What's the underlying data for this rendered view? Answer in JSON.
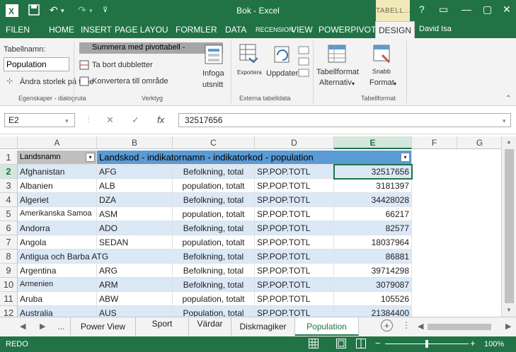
{
  "window": {
    "title": "Bok - Excel",
    "context_tab": "TABELL...",
    "controls": [
      "?",
      "▭",
      "—",
      "▢",
      "✕"
    ]
  },
  "tabs": {
    "file": "FILEN",
    "home": "HOME",
    "insert": "INSERT",
    "page_layout": "PAGE LAYOU",
    "formulas": "FORMLER",
    "data": "DATA",
    "review": "RECENSION",
    "view": "VIEW",
    "powerpivot": "POWERPIVOT",
    "design": "DESIGN",
    "user": "David Isa"
  },
  "ribbon": {
    "table_name_label": "Tabellnamn:",
    "table_name_value": "Population",
    "resize_table": "Ändra storlek på tabe",
    "group_properties": "Egenskaper - dialogruta",
    "summarize_pivot": "Summera med pivottabell -",
    "remove_duplicates": "Ta bort dubbletter",
    "convert_to_range": "Konvertera till område",
    "insert_slicer_1": "Infoga",
    "insert_slicer_2": "utsnitt",
    "group_tools": "Verktyg",
    "export": "Exportera",
    "refresh": "Uppdatera",
    "group_external": "Externa tabelldata",
    "table_style_options_1": "Tabellformat",
    "table_style_options_2": "Alternativ",
    "quick_styles_1": "Snabb",
    "quick_styles_2": "Format",
    "group_table_styles": "Tabellformat"
  },
  "formula_bar": {
    "name_box": "E2",
    "formula": "32517656",
    "fx": "fx"
  },
  "columns": [
    "A",
    "B",
    "C",
    "D",
    "E",
    "F",
    "G"
  ],
  "header_row": {
    "a": "Landsnamn",
    "merged": "Landskod - indikatornamn - indikatorkod - population"
  },
  "rows": [
    {
      "n": "1"
    },
    {
      "n": "2",
      "a": "Afghanistan",
      "b": "AFG",
      "c": "Befolkning, total",
      "d": "SP.POP.TOTL",
      "e": "32517656"
    },
    {
      "n": "3",
      "a": "Albanien",
      "b": "ALB",
      "c": "population, totalt",
      "d": "SP.POP.TOTL",
      "e": "3181397"
    },
    {
      "n": "4",
      "a": "Algeriet",
      "b": "DZA",
      "c": "Befolkning, total",
      "d": "SP.POP.TOTL",
      "e": "34428028"
    },
    {
      "n": "5",
      "a": "Amerikanska Samoa",
      "b": "ASM",
      "c": "population, totalt",
      "d": "SP.POP.TOTL",
      "e": "66217"
    },
    {
      "n": "6",
      "a": "Andorra",
      "b": "ADO",
      "c": "Befolkning, total",
      "d": "SP.POP.TOTL",
      "e": "82577"
    },
    {
      "n": "7",
      "a": "Angola",
      "b": "SEDAN",
      "c": "population, totalt",
      "d": "SP.POP.TOTL",
      "e": "18037964"
    },
    {
      "n": "8",
      "a": "Antigua och Barba ATG",
      "b": "",
      "c": "Befolkning, total",
      "d": "SP.POP.TOTL",
      "e": "86881"
    },
    {
      "n": "9",
      "a": "Argentina",
      "b": "ARG",
      "c": "Befolkning, total",
      "d": "SP.POP.TOTL",
      "e": "39714298"
    },
    {
      "n": "10",
      "a": "Armenien",
      "b": "ARM",
      "c": "Befolkning, total",
      "d": "SP.POP.TOTL",
      "e": "3079087"
    },
    {
      "n": "11",
      "a": "Aruba",
      "b": "ABW",
      "c": "population, totalt",
      "d": "SP.POP.TOTL",
      "e": "105526"
    },
    {
      "n": "12",
      "a": "Australia",
      "b": "AUS",
      "c": "Population, total",
      "d": "SP.POP.TOTL",
      "e": "21384400"
    }
  ],
  "sheets": {
    "ellipsis": "...",
    "s1": "Power View",
    "s2": "Sport",
    "s3": "Värdar",
    "s4": "Diskmagiker",
    "s5": "Population"
  },
  "status": {
    "mode": "REDO",
    "zoom": "100%"
  }
}
